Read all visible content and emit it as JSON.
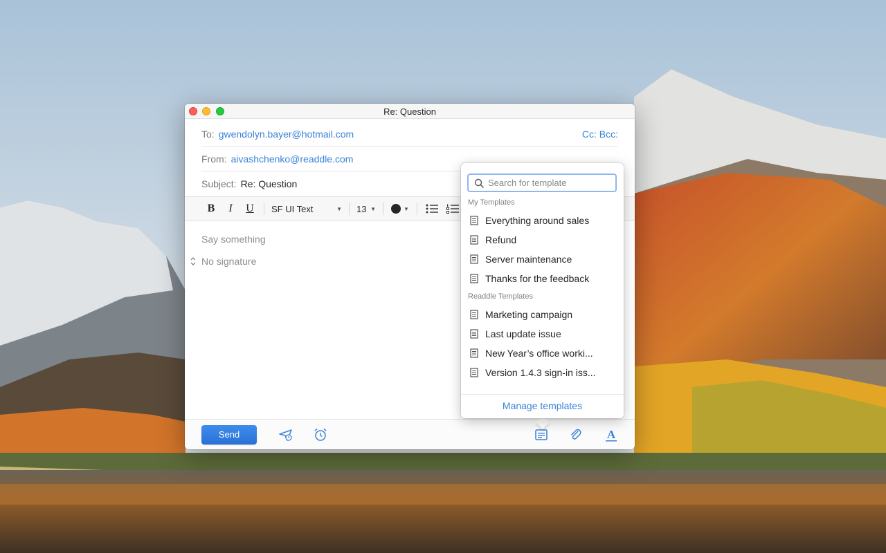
{
  "window": {
    "title": "Re: Question"
  },
  "compose": {
    "to_label": "To:",
    "to_value": "gwendolyn.bayer@hotmail.com",
    "cc_bcc": "Cc: Bcc:",
    "from_label": "From:",
    "from_value": "aivashchenko@readdle.com",
    "subject_label": "Subject:",
    "subject_value": "Re: Question",
    "body_placeholder": "Say something",
    "signature": "No signature"
  },
  "toolbar": {
    "bold": "B",
    "italic": "I",
    "underline": "U",
    "font_name": "SF UI Text",
    "font_size": "13",
    "text_color": "#262626"
  },
  "bottombar": {
    "send_label": "Send",
    "icons": [
      "send-later-icon",
      "reminder-clock-icon",
      "templates-icon",
      "attachment-icon",
      "formatting-icon"
    ]
  },
  "templates": {
    "search_placeholder": "Search for template",
    "my_header": "My Templates",
    "my_items": [
      "Everything around sales",
      "Refund",
      "Server maintenance",
      "Thanks for the feedback"
    ],
    "readdle_header": "Readdle Templates",
    "readdle_items": [
      "Marketing campaign",
      "Last update issue",
      "New Year’s office worki...",
      "Version 1.4.3 sign-in iss..."
    ],
    "manage_label": "Manage templates"
  },
  "colors": {
    "accent": "#3a82d7",
    "send_button": "#2f7ae0",
    "close": "#fd5f57",
    "minimize": "#febc2e",
    "maximize": "#28c840"
  }
}
